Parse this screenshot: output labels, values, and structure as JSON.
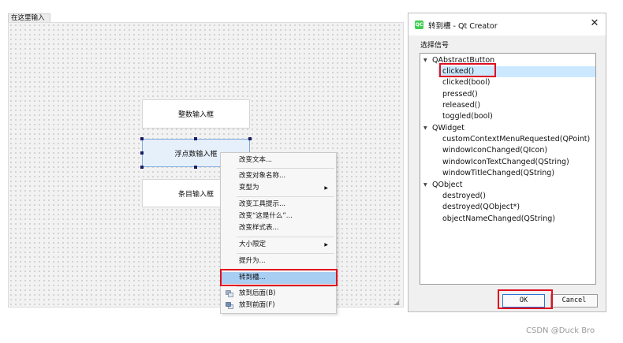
{
  "designer": {
    "menu_entry": "在这里输入",
    "buttons": {
      "int_input": "整数输入框",
      "float_input": "浮点数输入框",
      "item_input": "条目输入框"
    }
  },
  "context_menu": {
    "items": {
      "change_text": "改变文本...",
      "change_object_name": "改变对象名称...",
      "morph_into": "变型为",
      "change_tooltip": "改变工具提示...",
      "change_whats_this": "改变“这是什么”...",
      "change_stylesheet": "改变样式表...",
      "size_constraints": "大小限定",
      "promote_to": "提升为...",
      "go_to_slot": "转到槽...",
      "send_to_back": "放到后面(B)",
      "bring_to_front": "放到前面(F)"
    },
    "highlight_color": "#a8cef2"
  },
  "dialog": {
    "title": "转到槽 - Qt Creator",
    "logo_text": "QC",
    "group_label": "选择信号",
    "tree": {
      "groups": [
        {
          "label": "QAbstractButton",
          "signals": [
            "clicked()",
            "clicked(bool)",
            "pressed()",
            "released()",
            "toggled(bool)"
          ]
        },
        {
          "label": "QWidget",
          "signals": [
            "customContextMenuRequested(QPoint)",
            "windowIconChanged(QIcon)",
            "windowIconTextChanged(QString)",
            "windowTitleChanged(QString)"
          ]
        },
        {
          "label": "QObject",
          "signals": [
            "destroyed()",
            "destroyed(QObject*)",
            "objectNameChanged(QString)"
          ]
        }
      ],
      "selected": "clicked()"
    },
    "ok_label": "OK",
    "cancel_label": "Cancel"
  },
  "annotation_color": "#e01020",
  "watermark": "CSDN @Duck Bro"
}
